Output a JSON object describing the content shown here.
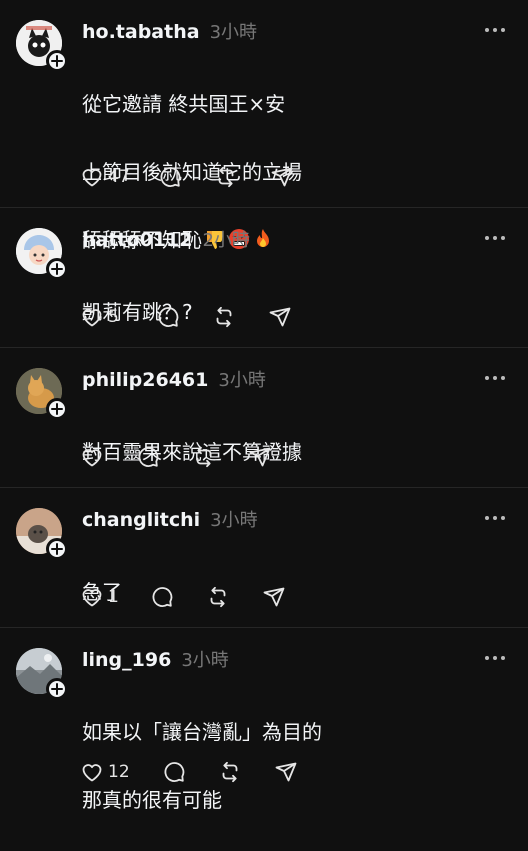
{
  "posts": [
    {
      "username": "ho.tabatha",
      "time": "3小時",
      "lines": [
        "從它邀請 終共国王×安",
        "上節目後就知道它的立場",
        "舔舔舔不知恥"
      ],
      "emojis": [
        "thumbs-down",
        "cursing-face",
        "fire"
      ],
      "like_count": "47"
    },
    {
      "username": "hatto0112",
      "time": "2小時",
      "lines": [
        "凱莉有跳？?"
      ],
      "like_count": "5"
    },
    {
      "username": "philip26461",
      "time": "3小時",
      "lines": [
        "對百靈果來說這不算證據"
      ],
      "like_count": ""
    },
    {
      "username": "changlitchi",
      "time": "3小時",
      "lines": [
        "急了"
      ],
      "like_count": "1"
    },
    {
      "username": "ling_196",
      "time": "3小時",
      "lines": [
        "如果以「讓台灣亂」為目的",
        "那真的很有可能"
      ],
      "like_count": "12"
    }
  ],
  "icons": {
    "like": "heart-icon",
    "comment": "comment-bubble-icon",
    "repost": "repost-icon",
    "share": "send-icon",
    "more": "more-dots-icon",
    "follow": "plus-icon"
  },
  "colors": {
    "background": "#101010",
    "text": "#f3f5f7",
    "secondary": "#777777",
    "divider": "#262626"
  }
}
